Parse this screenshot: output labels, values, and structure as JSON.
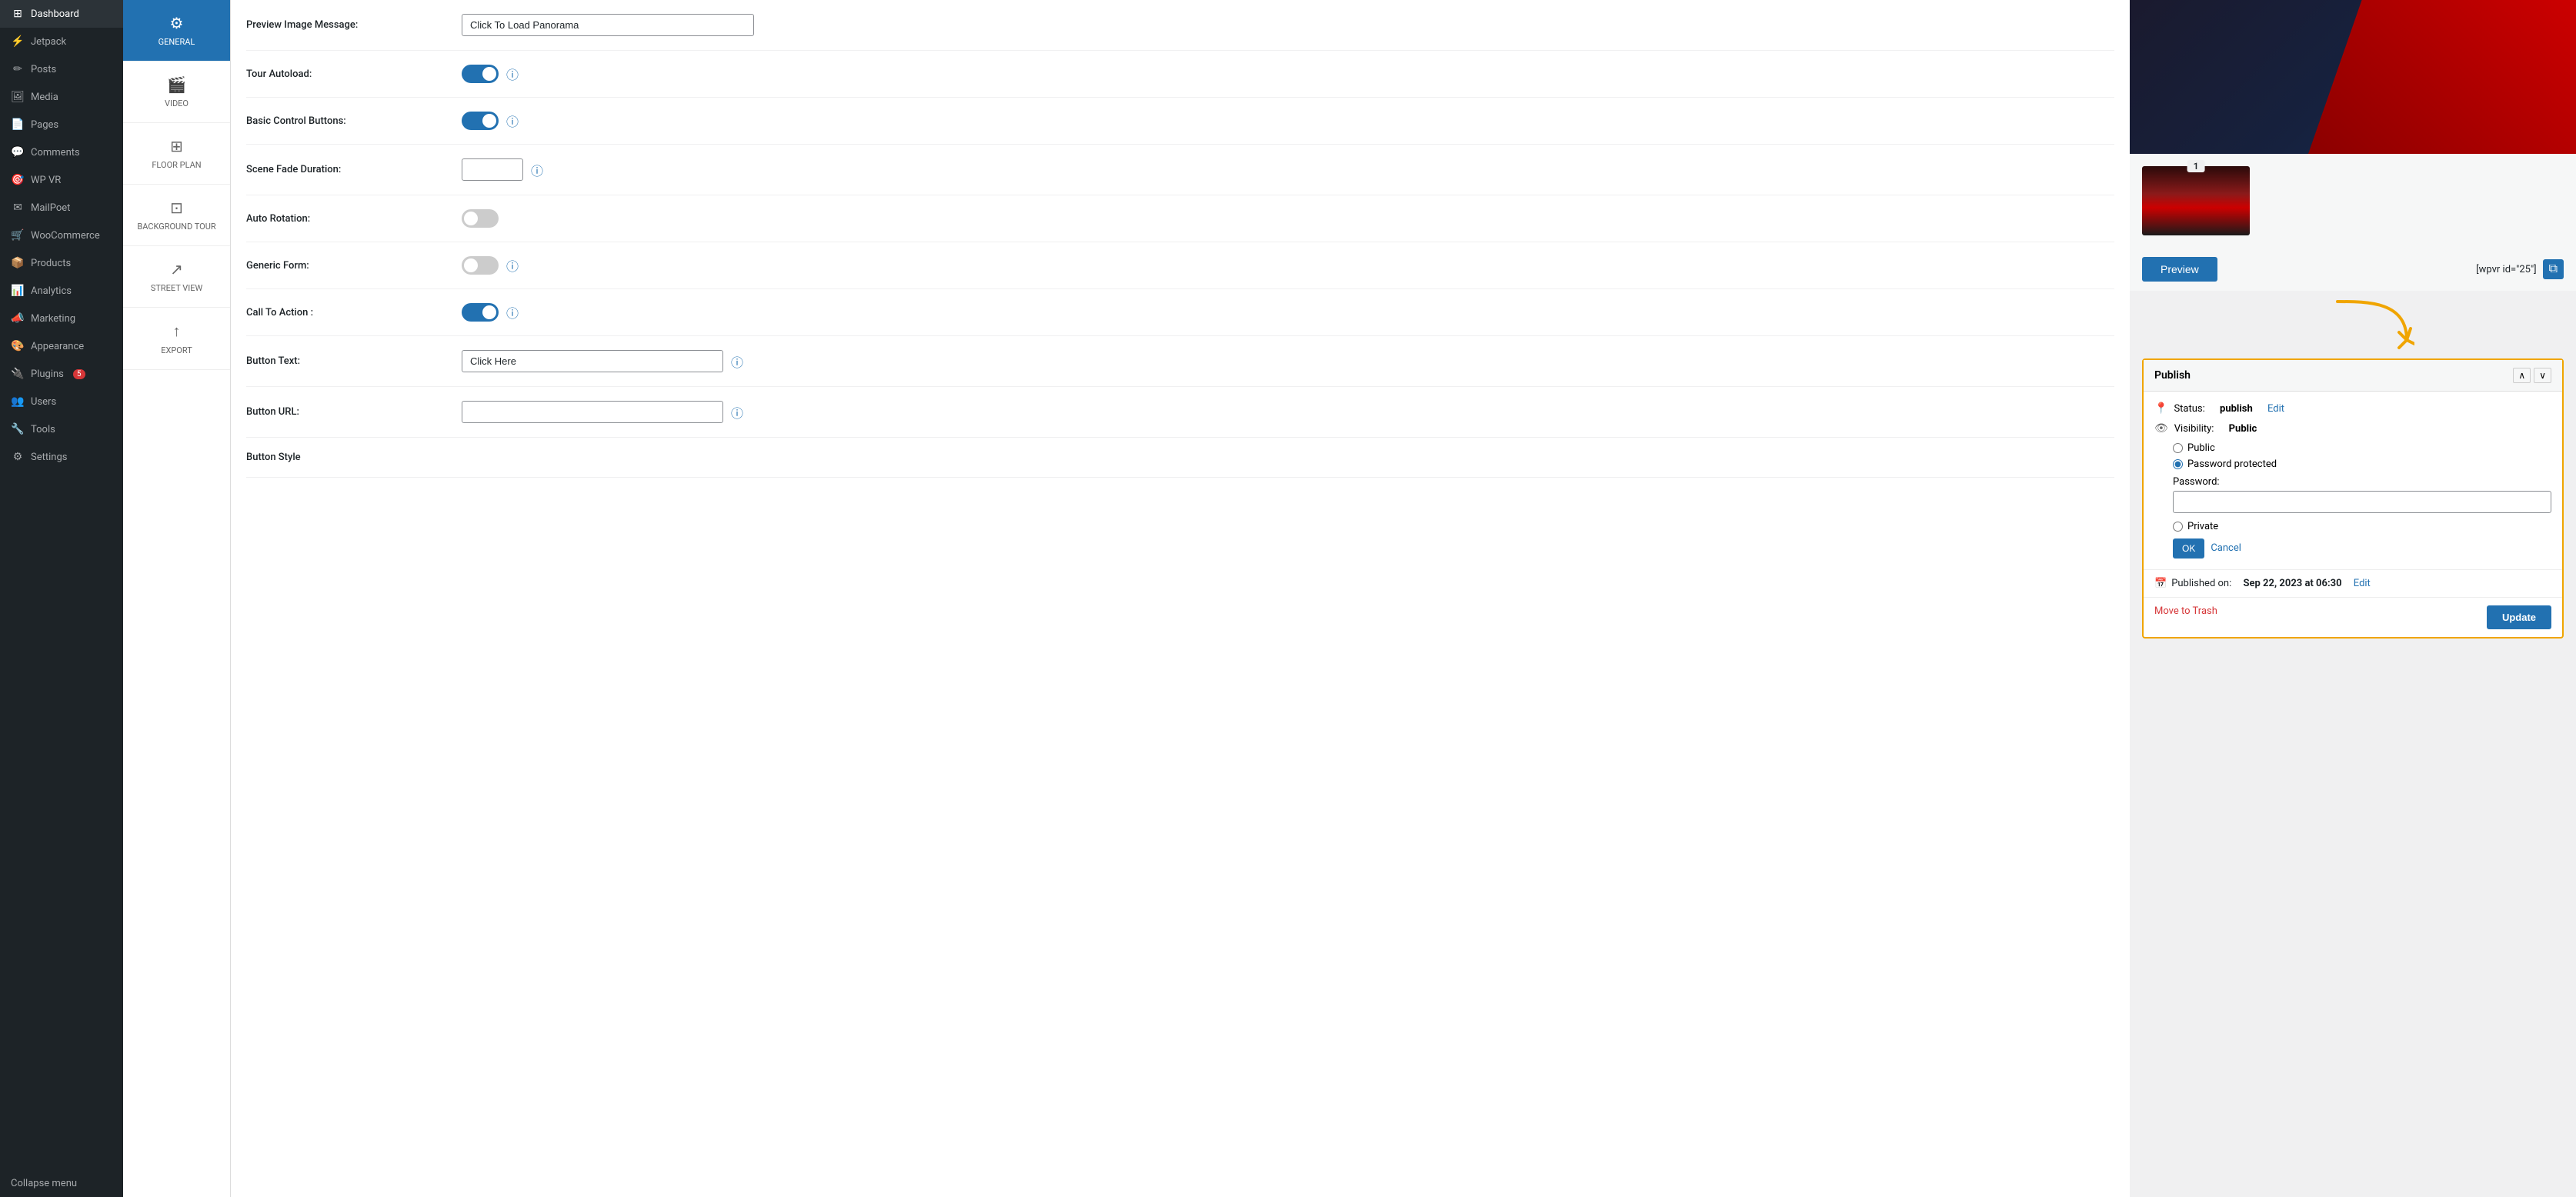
{
  "sidebar": {
    "items": [
      {
        "id": "dashboard",
        "label": "Dashboard",
        "icon": "⊞"
      },
      {
        "id": "jetpack",
        "label": "Jetpack",
        "icon": "⚡"
      },
      {
        "id": "posts",
        "label": "Posts",
        "icon": "📝"
      },
      {
        "id": "media",
        "label": "Media",
        "icon": "🖼"
      },
      {
        "id": "pages",
        "label": "Pages",
        "icon": "📄"
      },
      {
        "id": "comments",
        "label": "Comments",
        "icon": "💬"
      },
      {
        "id": "wpvr",
        "label": "WP VR",
        "icon": "🥽"
      },
      {
        "id": "mailpoet",
        "label": "MailPoet",
        "icon": "✉"
      },
      {
        "id": "woocommerce",
        "label": "WooCommerce",
        "icon": "🛒"
      },
      {
        "id": "products",
        "label": "Products",
        "icon": "📦"
      },
      {
        "id": "analytics",
        "label": "Analytics",
        "icon": "📊"
      },
      {
        "id": "marketing",
        "label": "Marketing",
        "icon": "📣"
      },
      {
        "id": "appearance",
        "label": "Appearance",
        "icon": "🎨"
      },
      {
        "id": "plugins",
        "label": "Plugins",
        "icon": "🔌",
        "badge": "5"
      },
      {
        "id": "users",
        "label": "Users",
        "icon": "👥"
      },
      {
        "id": "tools",
        "label": "Tools",
        "icon": "🔧"
      },
      {
        "id": "settings",
        "label": "Settings",
        "icon": "⚙"
      }
    ],
    "collapse_label": "Collapse menu"
  },
  "sub_sidebar": {
    "items": [
      {
        "id": "general",
        "label": "GENERAL",
        "icon": "⚙",
        "active": true
      },
      {
        "id": "video",
        "label": "VIDEO",
        "icon": "🎬",
        "active": false
      },
      {
        "id": "floor_plan",
        "label": "FLOOR PLAN",
        "icon": "⊞",
        "active": false
      },
      {
        "id": "background_tour",
        "label": "BACKGROUND TOUR",
        "icon": "⊡",
        "active": false
      },
      {
        "id": "street_view",
        "label": "STREET VIEW",
        "icon": "↗",
        "active": false
      },
      {
        "id": "export",
        "label": "EXPORT",
        "icon": "↑",
        "active": false
      }
    ]
  },
  "settings": {
    "rows": [
      {
        "id": "preview_image_message",
        "label": "Preview Image Message:",
        "type": "text",
        "value": "Click To Load Panorama",
        "placeholder": "Click To Load Panorama",
        "has_info": false
      },
      {
        "id": "tour_autoload",
        "label": "Tour Autoload:",
        "type": "toggle",
        "checked": true,
        "has_info": true
      },
      {
        "id": "basic_control_buttons",
        "label": "Basic Control Buttons:",
        "type": "toggle",
        "checked": true,
        "has_info": true
      },
      {
        "id": "scene_fade_duration",
        "label": "Scene Fade Duration:",
        "type": "text_small",
        "value": "",
        "has_info": true
      },
      {
        "id": "auto_rotation",
        "label": "Auto Rotation:",
        "type": "toggle",
        "checked": false,
        "has_info": false
      },
      {
        "id": "generic_form",
        "label": "Generic Form:",
        "type": "toggle",
        "checked": false,
        "has_info": true
      },
      {
        "id": "call_to_action",
        "label": "Call To Action :",
        "type": "toggle",
        "checked": true,
        "has_info": true
      },
      {
        "id": "button_text",
        "label": "Button Text:",
        "type": "text",
        "value": "Click Here",
        "placeholder": "Click Here",
        "has_info": true
      },
      {
        "id": "button_url",
        "label": "Button URL:",
        "type": "text",
        "value": "",
        "placeholder": "",
        "has_info": true
      },
      {
        "id": "button_style",
        "label": "Button Style",
        "type": "heading",
        "has_info": false
      }
    ]
  },
  "right_panel": {
    "thumbnail_badge": "1",
    "preview_button_label": "Preview",
    "shortcode_label": "[wpvr id=\"25\"]",
    "arrow_note": "",
    "publish": {
      "title": "Publish",
      "status_label": "Status:",
      "status_value": "publish",
      "status_edit": "Edit",
      "visibility_label": "Visibility:",
      "visibility_value": "Public",
      "radio_options": [
        {
          "id": "public",
          "label": "Public",
          "checked": false
        },
        {
          "id": "password_protected",
          "label": "Password protected",
          "checked": true
        },
        {
          "id": "private",
          "label": "Private",
          "checked": false
        }
      ],
      "password_label": "Password:",
      "password_value": "",
      "ok_label": "OK",
      "cancel_label": "Cancel",
      "published_on_label": "Published on:",
      "published_on_value": "Sep 22, 2023 at 06:30",
      "published_on_edit": "Edit",
      "move_to_trash_label": "Move to Trash",
      "update_label": "Update"
    }
  }
}
